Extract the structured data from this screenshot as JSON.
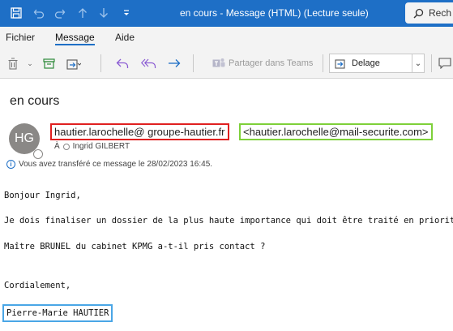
{
  "window": {
    "title": "en cours  -  Message (HTML) (Lecture seule)",
    "search_label": "Rech"
  },
  "menu": {
    "items": [
      "Fichier",
      "Message",
      "Aide"
    ],
    "active": "Message"
  },
  "ribbon": {
    "teams_label": "Partager dans Teams",
    "move_select_value": "Delage"
  },
  "message": {
    "subject": "en cours",
    "avatar_initials": "HG",
    "from_display": "hautier.larochelle@ groupe-hautier.fr",
    "from_address": "<hautier.larochelle@mail-securite.com>",
    "to_prefix": "À",
    "to_name": "Ingrid GILBERT",
    "info": "Vous avez transféré ce message le 28/02/2023 16:45.",
    "body": [
      "Bonjour Ingrid,",
      "Je dois finaliser un dossier de la plus haute importance qui doit être traité en priorité.",
      "Maître BRUNEL du cabinet KPMG a-t-il pris contact ?",
      "Cordialement,"
    ],
    "signature": "Pierre-Marie HAUTIER"
  },
  "colors": {
    "titlebar": "#1e6fc6",
    "highlight_from_name": "#e02020",
    "highlight_from_address": "#7ed03a",
    "highlight_signature": "#4aa6e6"
  },
  "icons": [
    "save-icon",
    "undo-icon",
    "redo-icon",
    "up-arrow-icon",
    "down-arrow-icon",
    "customize-icon",
    "search-icon",
    "delete-icon",
    "archive-icon",
    "move-icon",
    "reply-icon",
    "reply-all-icon",
    "forward-icon",
    "teams-icon",
    "move-to-folder-icon",
    "info-icon"
  ]
}
